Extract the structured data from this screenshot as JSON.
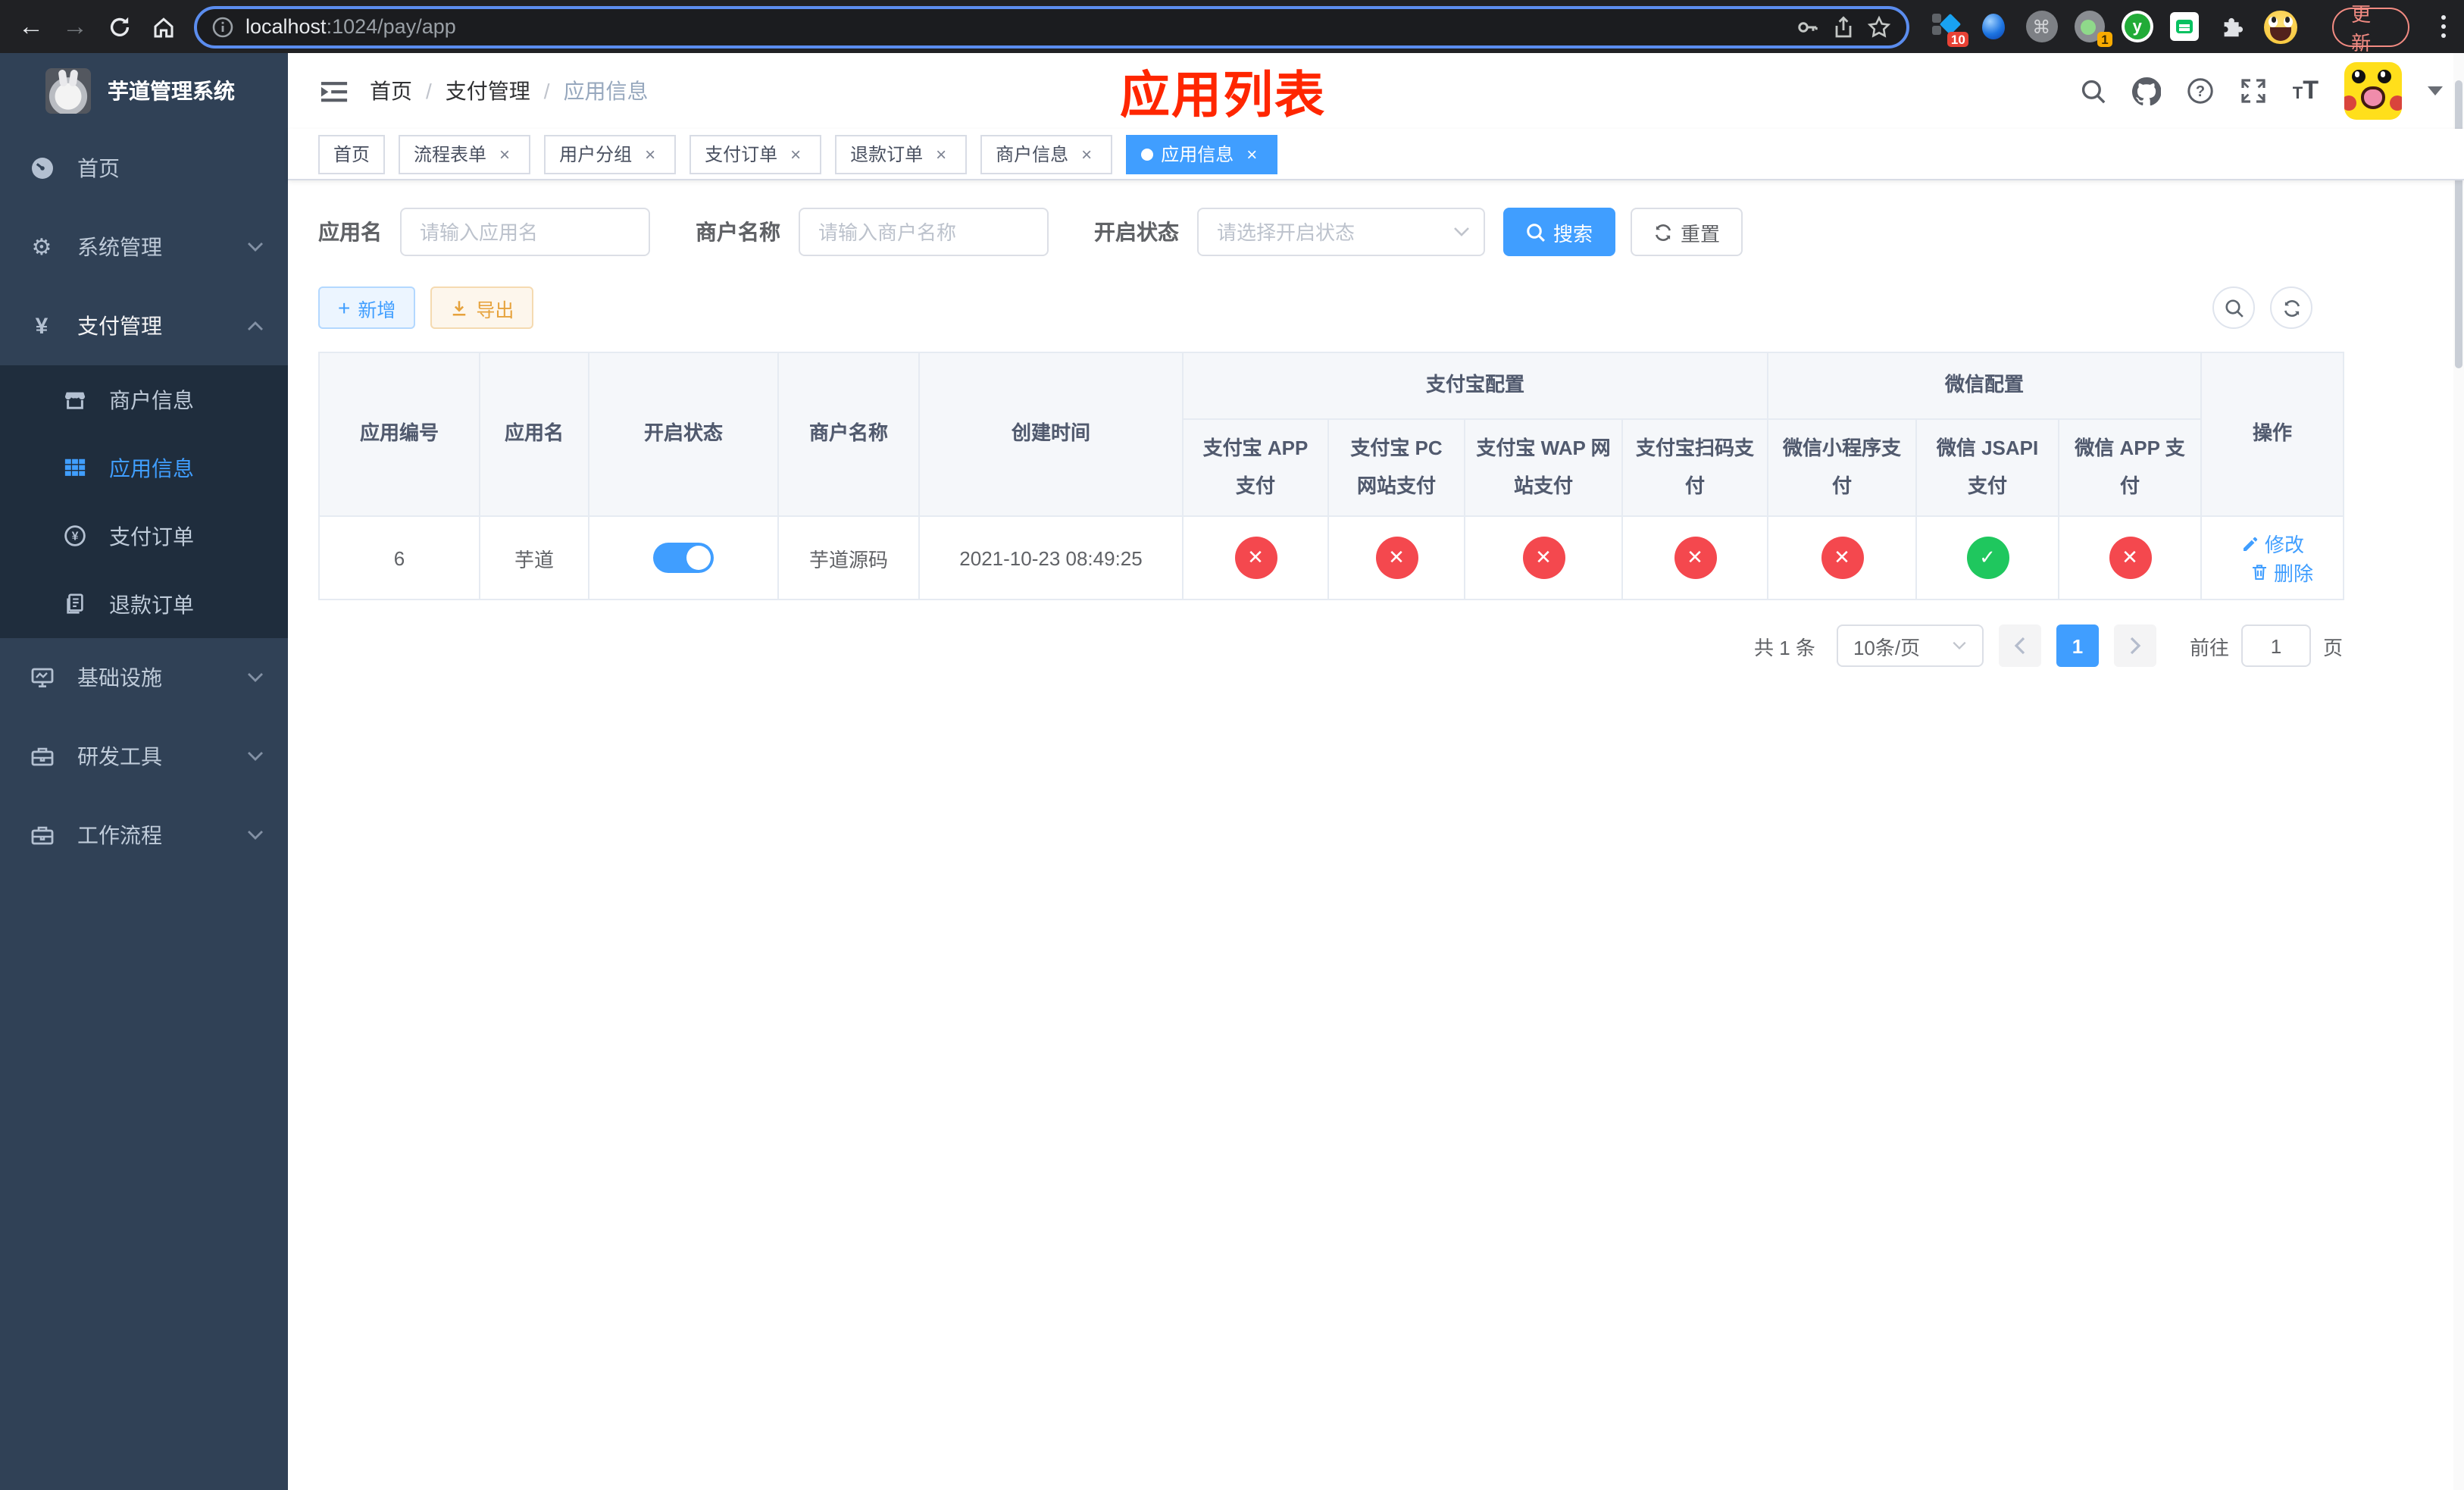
{
  "browser": {
    "url_host": "localhost",
    "url_rest": ":1024/pay/app",
    "update_label": "更新",
    "ext_badge_pixels": "10",
    "ext_badge_timer": "1"
  },
  "sidebar": {
    "title": "芋道管理系统",
    "items": [
      {
        "label": "首页"
      },
      {
        "label": "系统管理"
      },
      {
        "label": "支付管理"
      },
      {
        "label": "基础设施"
      },
      {
        "label": "研发工具"
      },
      {
        "label": "工作流程"
      }
    ],
    "submenu": [
      {
        "label": "商户信息"
      },
      {
        "label": "应用信息"
      },
      {
        "label": "支付订单"
      },
      {
        "label": "退款订单"
      }
    ]
  },
  "header": {
    "breadcrumb": [
      "首页",
      "支付管理",
      "应用信息"
    ],
    "annotation": "应用列表"
  },
  "tabs": [
    {
      "label": "首页"
    },
    {
      "label": "流程表单"
    },
    {
      "label": "用户分组"
    },
    {
      "label": "支付订单"
    },
    {
      "label": "退款订单"
    },
    {
      "label": "商户信息"
    },
    {
      "label": "应用信息"
    }
  ],
  "filters": {
    "app_name_label": "应用名",
    "app_name_placeholder": "请输入应用名",
    "merchant_label": "商户名称",
    "merchant_placeholder": "请输入商户名称",
    "status_label": "开启状态",
    "status_placeholder": "请选择开启状态",
    "search_label": "搜索",
    "reset_label": "重置"
  },
  "toolbar": {
    "add_label": "新增",
    "export_label": "导出"
  },
  "table": {
    "columns": [
      "应用编号",
      "应用名",
      "开启状态",
      "商户名称",
      "创建时间"
    ],
    "group_alipay": "支付宝配置",
    "group_wechat": "微信配置",
    "alipay_cols": [
      "支付宝 APP 支付",
      "支付宝 PC 网站支付",
      "支付宝 WAP 网站支付",
      "支付宝扫码支付"
    ],
    "wechat_cols": [
      "微信小程序支付",
      "微信 JSAPI 支付",
      "微信 APP 支付"
    ],
    "action_col": "操作",
    "rows": [
      {
        "id": "6",
        "name": "芋道",
        "enabled": true,
        "merchant": "芋道源码",
        "created": "2021-10-23 08:49:25",
        "statuses": [
          "no",
          "no",
          "no",
          "no",
          "no",
          "yes",
          "no"
        ],
        "edit_label": "修改",
        "delete_label": "删除"
      }
    ]
  },
  "pagination": {
    "total": "共 1 条",
    "page_size": "10条/页",
    "current": "1",
    "goto_label": "前往",
    "goto_value": "1",
    "page_unit": "页"
  },
  "colors": {
    "primary": "#409eff",
    "danger": "#f4484e",
    "success": "#1fc75e",
    "sidebar_bg": "#304156",
    "submenu_bg": "#1f2d3d"
  }
}
